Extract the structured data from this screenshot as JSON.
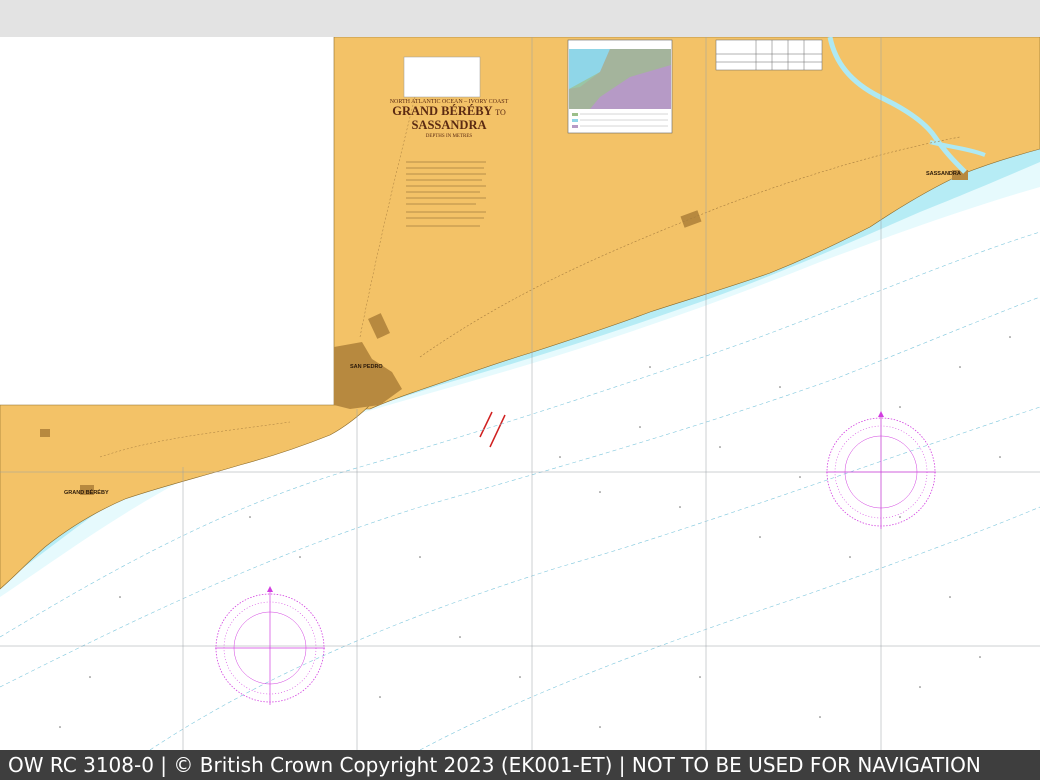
{
  "footer": {
    "text": "OW RC 3108-0 | © British Crown Copyright 2023 (EK001-ET) | NOT TO BE USED FOR NAVIGATION"
  },
  "chart_title": {
    "region": "NORTH ATLANTIC OCEAN – IVORY COAST",
    "name_line1": "GRAND BÉRÉBY",
    "to_word": "TO",
    "name_line2": "SASSANDRA",
    "units": "DEPTHS IN METRES"
  },
  "places": {
    "san_pedro": "SAN PEDRO",
    "grand_bereby": "GRAND BÉRÉBY",
    "sassandra": "SASSANDRA"
  },
  "colors": {
    "land": "#f3c267",
    "shallow_water": "#aee9f3",
    "mid_water": "#d8f6fb",
    "deep_water": "#ffffff",
    "urban": "#b7893f",
    "compass_rose": "#d23ee0",
    "grid_line": "#9aa0a6"
  }
}
